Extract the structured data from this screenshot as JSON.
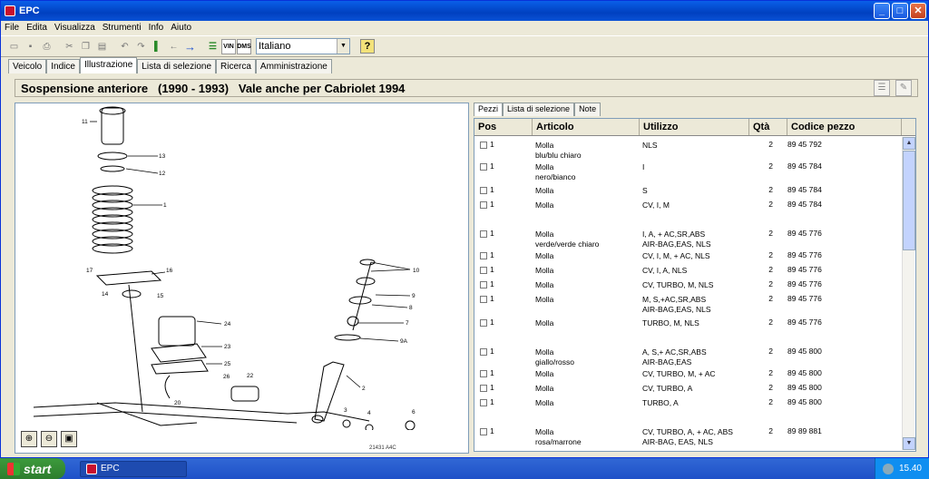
{
  "window": {
    "title": "EPC",
    "min": "_",
    "max": "□",
    "close": "✕"
  },
  "menu": [
    "File",
    "Edita",
    "Visualizza",
    "Strumenti",
    "Info",
    "Aiuto"
  ],
  "toolbar": {
    "language": "Italiano",
    "vin_label": "VIN",
    "dms_label": "DMS",
    "help": "?"
  },
  "tabs": [
    "Veicolo",
    "Indice",
    "Illustrazione",
    "Lista di selezione",
    "Ricerca",
    "Amministrazione"
  ],
  "active_tab": "Illustrazione",
  "header": {
    "title": "Sospensione anteriore   (1990 - 1993)   Vale anche per Cabriolet 1994"
  },
  "right_tabs": [
    "Pezzi",
    "Lista di selezione",
    "Note"
  ],
  "table": {
    "columns": [
      "Pos",
      "Articolo",
      "Utilizzo",
      "Qtà",
      "Codice pezzo"
    ],
    "rows": [
      {
        "pos": "1",
        "articolo": "Molla",
        "articolo2": "blu/blu chiaro",
        "utilizzo": "NLS",
        "utilizzo2": "",
        "qta": "2",
        "codice": "89 45 792"
      },
      {
        "pos": "1",
        "articolo": "Molla",
        "articolo2": "nero/bianco",
        "utilizzo": "I",
        "utilizzo2": "",
        "qta": "2",
        "codice": "89 45 784"
      },
      {
        "pos": "1",
        "articolo": "Molla",
        "articolo2": "",
        "utilizzo": "S",
        "utilizzo2": "",
        "qta": "2",
        "codice": "89 45 784"
      },
      {
        "pos": "1",
        "articolo": "Molla",
        "articolo2": "",
        "utilizzo": "CV, I, M",
        "utilizzo2": "",
        "qta": "2",
        "codice": "89 45 784"
      },
      {
        "pos": "1",
        "articolo": "Molla",
        "articolo2": "verde/verde chiaro",
        "utilizzo": "I, A, + AC,SR,ABS",
        "utilizzo2": "AIR-BAG,EAS, NLS",
        "qta": "2",
        "codice": "89 45 776"
      },
      {
        "pos": "1",
        "articolo": "Molla",
        "articolo2": "",
        "utilizzo": "CV, I, M, + AC, NLS",
        "utilizzo2": "",
        "qta": "2",
        "codice": "89 45 776"
      },
      {
        "pos": "1",
        "articolo": "Molla",
        "articolo2": "",
        "utilizzo": "CV, I, A, NLS",
        "utilizzo2": "",
        "qta": "2",
        "codice": "89 45 776"
      },
      {
        "pos": "1",
        "articolo": "Molla",
        "articolo2": "",
        "utilizzo": "CV, TURBO, M, NLS",
        "utilizzo2": "",
        "qta": "2",
        "codice": "89 45 776"
      },
      {
        "pos": "1",
        "articolo": "Molla",
        "articolo2": "",
        "utilizzo": "M, S,+AC,SR,ABS",
        "utilizzo2": "AIR-BAG,EAS, NLS",
        "qta": "2",
        "codice": "89 45 776"
      },
      {
        "pos": "1",
        "articolo": "Molla",
        "articolo2": "",
        "utilizzo": "TURBO, M, NLS",
        "utilizzo2": "",
        "qta": "2",
        "codice": "89 45 776"
      },
      {
        "pos": "1",
        "articolo": "Molla",
        "articolo2": "giallo/rosso",
        "utilizzo": "A, S,+ AC,SR,ABS",
        "utilizzo2": "AIR-BAG,EAS",
        "qta": "2",
        "codice": "89 45 800"
      },
      {
        "pos": "1",
        "articolo": "Molla",
        "articolo2": "",
        "utilizzo": "CV, TURBO, M, + AC",
        "utilizzo2": "",
        "qta": "2",
        "codice": "89 45 800"
      },
      {
        "pos": "1",
        "articolo": "Molla",
        "articolo2": "",
        "utilizzo": "CV, TURBO, A",
        "utilizzo2": "",
        "qta": "2",
        "codice": "89 45 800"
      },
      {
        "pos": "1",
        "articolo": "Molla",
        "articolo2": "",
        "utilizzo": "TURBO, A",
        "utilizzo2": "",
        "qta": "2",
        "codice": "89 45 800"
      },
      {
        "pos": "1",
        "articolo": "Molla",
        "articolo2": "rosa/marrone",
        "utilizzo": "CV, TURBO, A, + AC, ABS",
        "utilizzo2": "AIR-BAG, EAS, NLS",
        "qta": "2",
        "codice": "89 89 881"
      }
    ]
  },
  "diagram": {
    "labels": [
      "11",
      "13",
      "12",
      "1",
      "17",
      "16",
      "14",
      "15",
      "24",
      "23",
      "25",
      "26",
      "22",
      "20",
      "10",
      "9",
      "8",
      "7",
      "9A",
      "2",
      "3",
      "4",
      "6"
    ],
    "footer": "21431 A4C"
  },
  "taskbar": {
    "start": "start",
    "task": "EPC",
    "time": "15.40"
  }
}
